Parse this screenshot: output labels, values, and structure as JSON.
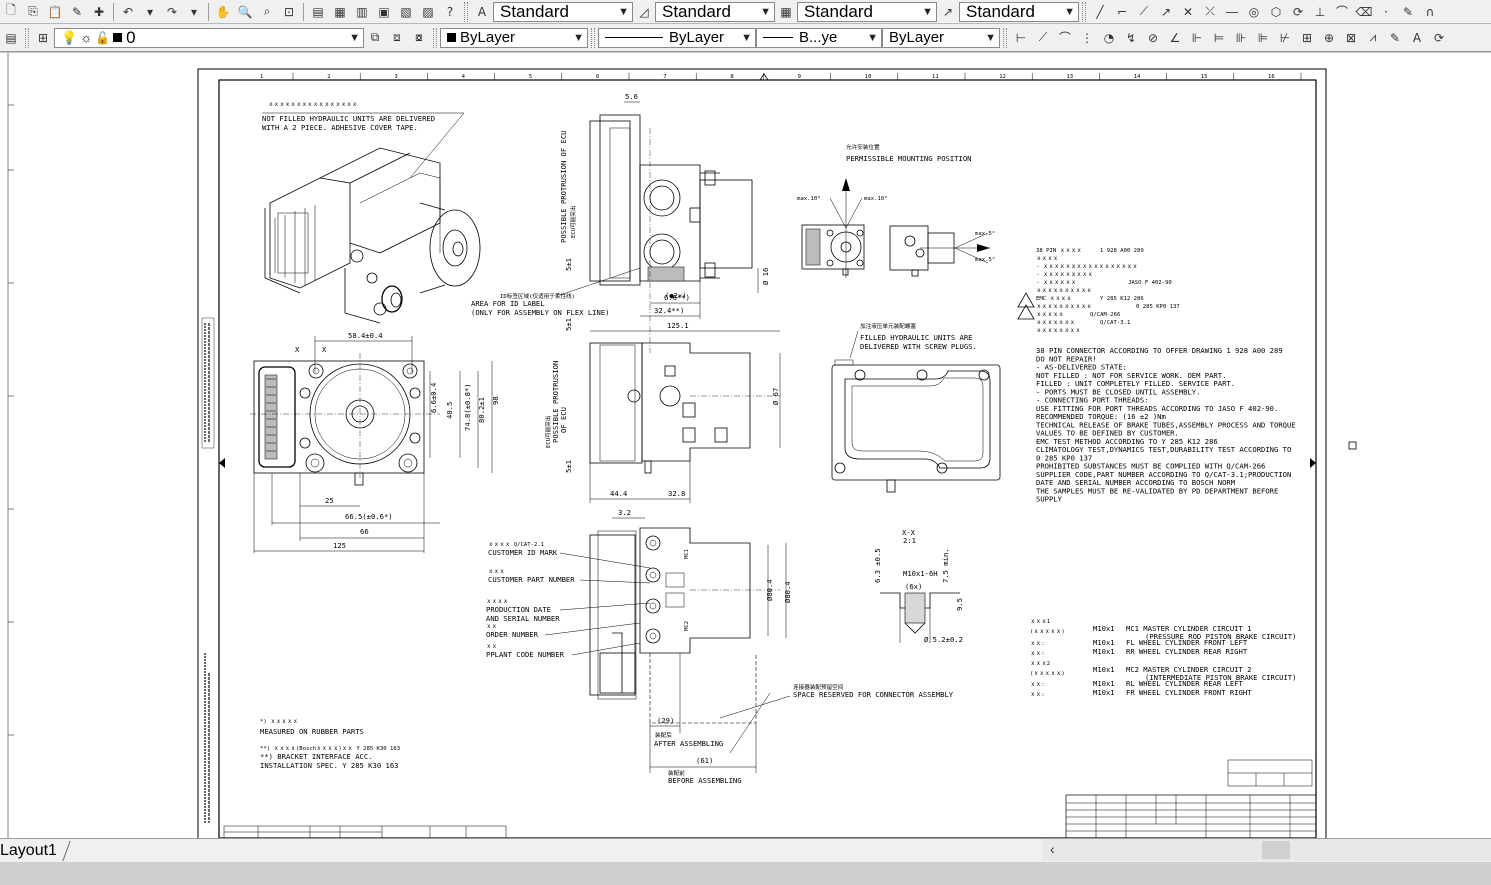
{
  "toolbar1": {
    "text_style": "Standard",
    "dim_style": "Standard",
    "table_style": "Standard",
    "mleader_style": "Standard"
  },
  "toolbar2": {
    "layer_name": "0",
    "color": "ByLayer",
    "linetype": "ByLayer",
    "lineweight": "B...ye",
    "plotstyle": "ByLayer"
  },
  "layout_tab": "Layout1",
  "drawing": {
    "ruler_numbers": [
      "1",
      "2",
      "3",
      "4",
      "5",
      "6",
      "7",
      "8",
      "9",
      "10",
      "11",
      "12",
      "13",
      "14",
      "15",
      "16"
    ],
    "notes": {
      "cover_tape": [
        "NOT FILLED HYDRAULIC UNITS ARE DELIVERED",
        "WITH A 2 PIECE. ADHESIVE COVER TAPE."
      ],
      "id_label": [
        "AREA FOR ID LABEL",
        "(ONLY FOR ASSEMBLY ON FLEX LINE)"
      ],
      "mounting": "PERMISSIBLE MOUNTING POSITION",
      "screw_plugs": [
        "FILLED HYDRAULIC UNITS ARE",
        "DELIVERED WITH SCREW PLUGS."
      ],
      "ecu_protrusion": "POSSIBLE PROTRUSION OF ECU",
      "customer_id": "CUSTOMER ID MARK",
      "customer_part": "CUSTOMER PART NUMBER",
      "production_date": [
        "PRODUCTION DATE",
        "AND SERIAL NUMBER"
      ],
      "order_number": "ORDER NUMBER",
      "plant_code": "PPLANT CODE NUMBER",
      "connector_space": "SPACE RESERVED FOR CONNECTOR ASSEMBLY",
      "after_assembling": "AFTER ASSEMBLING",
      "before_assembling": "BEFORE ASSEMBLING",
      "rubber": [
        "*) MEASURED ON RUBBER PARTS"
      ],
      "bracket": [
        "**) BRACKET INTERFACE ACC.",
        "INSTALLATION SPEC. Y 285 K30 163"
      ]
    },
    "spec_block": [
      "38 PIN CONNECTOR ACCORDING TO OFFER DRAWING 1 928 A00 289",
      "DO NOT REPAIR!",
      "- AS-DELIVERED STATE:",
      "  NOT FILLED : NOT FOR SERVICE WORK. OEM PART.",
      "  FILLED     : UNIT COMPLETELY FILLED. SERVICE PART.",
      "- PORTS MUST BE CLOSED UNTIL ASSEMBLY.",
      "- CONNECTING PORT THREADS:",
      "  USE FITTING FOR PORT THREADS ACCORDING TO JASO F 402-90.",
      "  RECOMMENDED  TORQUE: (16 ±2 )Nm",
      "TECHNICAL RELEASE OF BRAKE TUBES,ASSEMBLY PROCESS AND TORQUE",
      "VALUES TO BE DEFINED BY CUSTOMER.",
      "EMC TEST METHOD ACCORDING TO Y 285 K12 286",
      "CLIMATOLOGY TEST,DYNAMICS TEST,DURABILITY TEST ACCORDING TO",
      "0 285 KP0 137",
      "PROHIBITED SUBSTANCES MUST BE COMPLIED WITH Q/CAM-266",
      "SUPPLIER CODE,PART NUMBER ACCORDING TO Q/CAT-3.1;PRODUCTION",
      "DATE AND SERIAL NUMBER ACCORDING TO BOSCH NORM",
      "THE SAMPLES MUST BE RE-VALIDATED BY PD DEPARTMENT BEFORE",
      "SUPPLY"
    ],
    "spec_block_top": [
      "1 928 A00 289",
      "JASO F 402-90",
      "Y 285 K12 286",
      "0 285 KP0 137",
      "Q/CAM-266",
      "Q/CAT-3.1"
    ],
    "ports": [
      {
        "code": "M10x1",
        "line1": "MC1 MASTER CYLINDER CIRCUIT 1",
        "line2": "(PRESSURE ROD PISTON BRAKE CIRCUIT)"
      },
      {
        "code": "M10x1",
        "line1": "FL WHEEL CYLINDER   FRONT LEFT",
        "line2": ""
      },
      {
        "code": "M10x1",
        "line1": "RR WHEEL CYLINDER   REAR RIGHT",
        "line2": ""
      },
      {
        "code": "M10x1",
        "line1": "MC2 MASTER CYLINDER CIRCUIT 2",
        "line2": "(INTERMEDIATE PISTON BRAKE CIRCUIT)"
      },
      {
        "code": "M10x1",
        "line1": "RL WHEEL CYLINDER   REAR LEFT",
        "line2": ""
      },
      {
        "code": "M10x1",
        "line1": "FR WHEEL CYLINDER   FRONT RIGHT",
        "line2": ""
      }
    ],
    "dims": {
      "d_58_4": "58.4±0.4",
      "d_66_5": "66.5(±0.6*)",
      "d_66": "66",
      "d_125": "125",
      "d_25": "25",
      "d_5_6": "5.6",
      "d_6_6": "6.6**)",
      "d_32_4": "32.4**)",
      "d_125_1": "125.1",
      "d_44_4": "44.4",
      "d_32_8": "32.8",
      "d_3_2": "3.2",
      "d_29": "(29)",
      "d_61": "(61)",
      "d_phi67": "Ø 67",
      "d_m10": "M10x1-6H",
      "d_5_2": "Ø 5.2±0.2",
      "d_xx": "X-X",
      "d_21": "2:1",
      "d_6x": "(6x)",
      "d_7_5": "7.5 min.",
      "d_9_5": "9.5",
      "d_6_3": "6.3 ±0.5",
      "max10a": "max.10°",
      "max10b": "max.10°",
      "max5a": "max.5°",
      "max5b": "max.5°",
      "labels_x": "X"
    },
    "port_labels": [
      "MC1",
      "MC2"
    ]
  }
}
